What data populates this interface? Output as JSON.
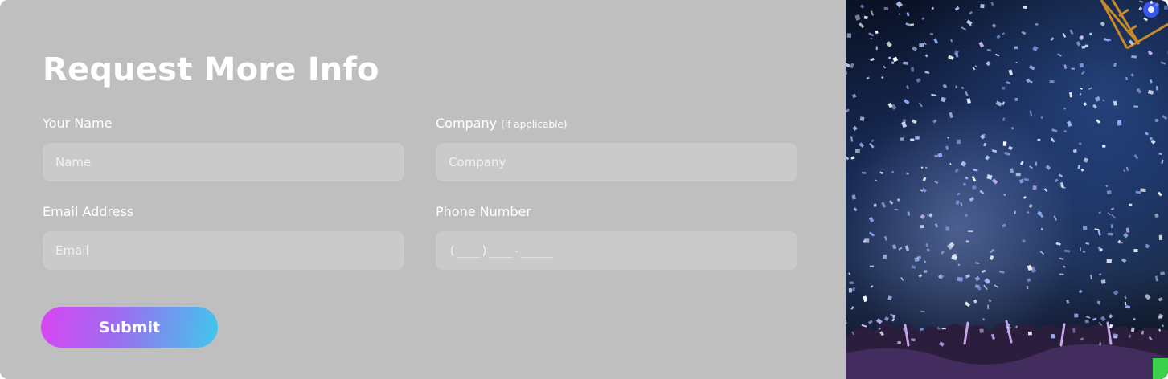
{
  "form": {
    "title": "Request More Info",
    "fields": {
      "name": {
        "label": "Your Name",
        "placeholder": "Name"
      },
      "company": {
        "label": "Company",
        "hint": "(if applicable)",
        "placeholder": "Company"
      },
      "email": {
        "label": "Email Address",
        "placeholder": "Email"
      },
      "phone": {
        "label": "Phone Number",
        "placeholder": "(___)___-____"
      }
    },
    "submit_label": "Submit"
  },
  "photo": {
    "icon": "concert-confetti-photo",
    "colors": {
      "sky": "#0a1226",
      "glow": "#7d8cd0",
      "confetti": "#cfd6ff"
    }
  },
  "colors": {
    "panel_bg": "#bfbfbf",
    "button_gradient_start": "#d945f2",
    "button_gradient_end": "#3fc8ec"
  }
}
